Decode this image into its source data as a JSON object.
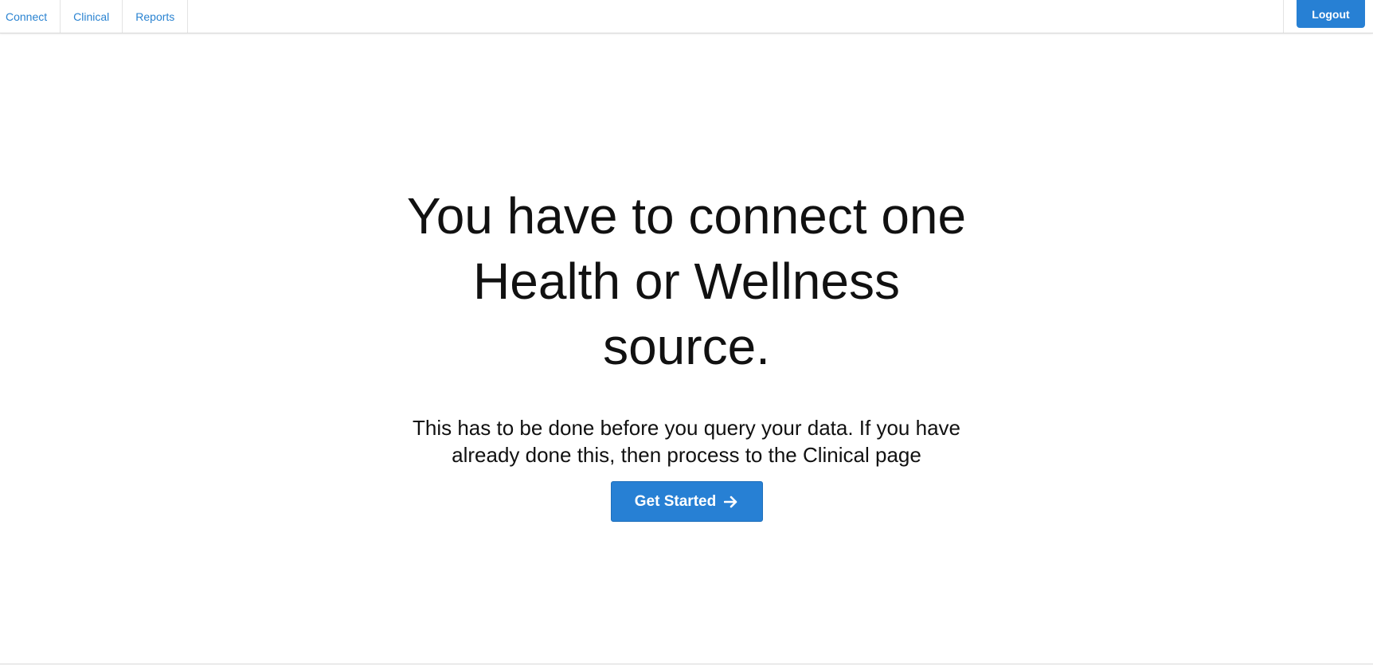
{
  "nav": {
    "items": [
      {
        "label": "Connect"
      },
      {
        "label": "Clinical"
      },
      {
        "label": "Reports"
      }
    ],
    "logout_label": "Logout"
  },
  "hero": {
    "title": "You have to connect one Health or Wellness source.",
    "subtitle": "This has to be done before you query your data. If you have already done this, then process to the Clinical page",
    "cta_label": "Get Started",
    "cta_icon": "arrow-right-icon"
  },
  "colors": {
    "accent": "#2780d4",
    "link": "#2a83d1",
    "border": "#d8d8d8"
  }
}
